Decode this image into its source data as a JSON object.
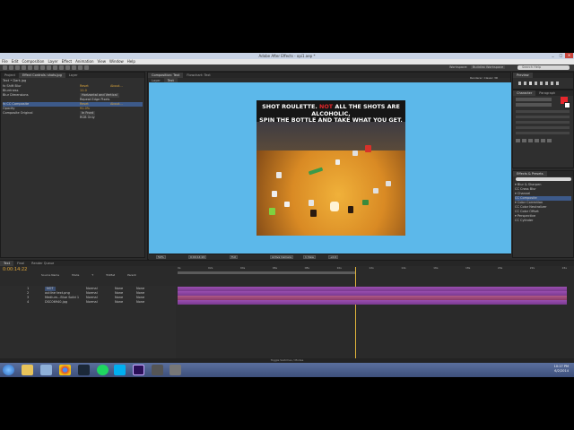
{
  "window": {
    "title": "Adobe After Effects - opi1.aep *",
    "controls": [
      "_",
      "□",
      "✕"
    ]
  },
  "menubar": [
    "File",
    "Edit",
    "Composition",
    "Layer",
    "Effect",
    "Animation",
    "View",
    "Window",
    "Help"
  ],
  "toolbar": {
    "workspace_label": "Workspace:",
    "workspace_value": "Buildlist Workspace",
    "search_placeholder": "Search Help"
  },
  "effect_controls": {
    "tabs": [
      "Project",
      "Effect Controls: shots.jpg",
      "Layer"
    ],
    "breadcrumb": "Text • Dark.jpg",
    "rows": [
      {
        "label": "fx  Shift Blur",
        "value": "Reset",
        "value2": "About..."
      },
      {
        "label": "   Blurriness",
        "value": "11.0"
      },
      {
        "label": "   Blur Dimensions",
        "value": "Horizontal and Vertical"
      },
      {
        "label": "",
        "value": "Repeat Edge Pixels"
      },
      {
        "label": "fx  CC Composite",
        "value": "Reset",
        "value2": "About...",
        "selected": true
      },
      {
        "label": "   Opacity",
        "value": "91.0%"
      },
      {
        "label": "   Composite Original",
        "value": "In Front"
      },
      {
        "label": "",
        "value": "RGB Only"
      }
    ]
  },
  "composition": {
    "tabs": [
      "Composition: Text",
      "Flowchart: Text"
    ],
    "subtabs": [
      "Layer",
      "Text"
    ],
    "caption_line1_pre": "SHOT ROULETTE.",
    "caption_not": "NOT",
    "caption_line1_post": "ALL THE SHOTS ARE ALCOHOLIC,",
    "caption_line2": "SPIN THE BOTTLE AND TAKE WHAT YOU GET.",
    "viewer_controls": [
      "50%",
      "0:00:14:22",
      "Full",
      "Active Camera",
      "1 View",
      "+0.0"
    ],
    "renderer_label": "Renderer:",
    "renderer_value": "Classic 3D"
  },
  "preview_panel": {
    "tabs": [
      "Preview"
    ]
  },
  "character_panel": {
    "tabs": [
      "Character",
      "Paragraph"
    ],
    "accent_color": "#e8272c"
  },
  "effects_presets": {
    "tabs": [
      "Effects & Presets"
    ],
    "items": [
      {
        "label": "▾ Blur & Sharpen"
      },
      {
        "label": "   CC Cross Blur"
      },
      {
        "label": "▾ Channel"
      },
      {
        "label": "   CC Composite",
        "selected": true
      },
      {
        "label": "▾ Color Correction"
      },
      {
        "label": "   CC Color Neutralizer"
      },
      {
        "label": "   CC Color Offset"
      },
      {
        "label": "▾ Perspective"
      },
      {
        "label": "   CC Cylinder"
      }
    ]
  },
  "timeline": {
    "tabs": [
      "Text",
      "Final",
      "Render Queue"
    ],
    "timecode": "0:00:14:22",
    "columns": [
      "Source Name",
      "Mode",
      "T",
      "TrkMat",
      "Parent"
    ],
    "ruler_ticks": [
      "0s",
      "02s",
      "04s",
      "06s",
      "08s",
      "10s",
      "12s",
      "14s",
      "16s",
      "18s",
      "20s",
      "22s",
      "24s"
    ],
    "layers": [
      {
        "num": "1",
        "name": "NOT",
        "mode": "Normal",
        "trkmat": "None",
        "parent": "None"
      },
      {
        "num": "2",
        "name": "outline text.png",
        "mode": "Normal",
        "trkmat": "None",
        "parent": "None"
      },
      {
        "num": "3",
        "name": "Medium...Blue Solid 1",
        "mode": "Normal",
        "trkmat": "None",
        "parent": "None"
      },
      {
        "num": "4",
        "name": "DSC06940.jpg",
        "mode": "Normal",
        "trkmat": "None",
        "parent": "None"
      }
    ],
    "toggle_label": "Toggle Switches / Modes"
  },
  "taskbar": {
    "time": "10:17 PM",
    "date": "6/2/2014"
  }
}
